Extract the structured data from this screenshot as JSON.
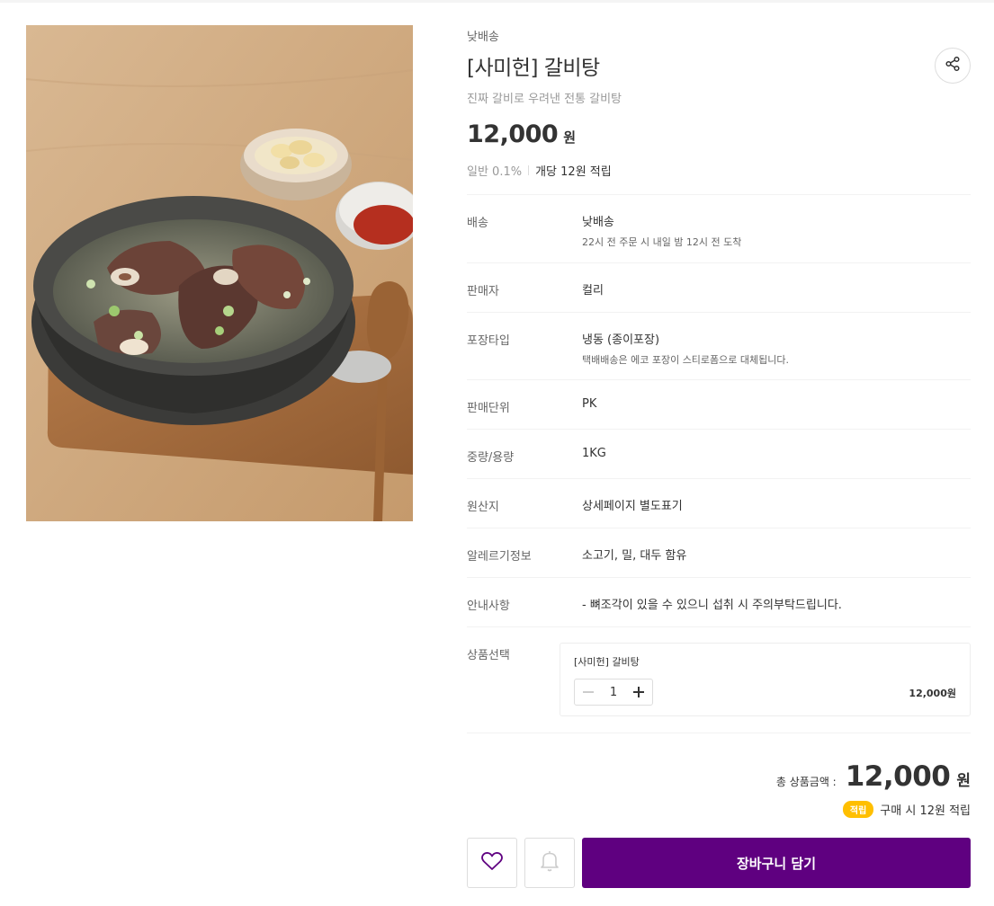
{
  "product": {
    "delivery_tag": "낮배송",
    "title": "[사미헌] 갈비탕",
    "subtitle": "진짜 갈비로 우려낸 전통 갈비탕",
    "price": "12,000",
    "price_unit": "원",
    "points_grade": "일반 0.1%",
    "points_per_unit": "개당 12원 적립"
  },
  "details": [
    {
      "label": "배송",
      "value": "낮배송",
      "sub": "22시 전 주문 시 내일 밤 12시 전 도착"
    },
    {
      "label": "판매자",
      "value": "컬리",
      "sub": ""
    },
    {
      "label": "포장타입",
      "value": "냉동 (종이포장)",
      "sub": "택배배송은 에코 포장이 스티로폼으로 대체됩니다."
    },
    {
      "label": "판매단위",
      "value": "PK",
      "sub": ""
    },
    {
      "label": "중량/용량",
      "value": "1KG",
      "sub": ""
    },
    {
      "label": "원산지",
      "value": "상세페이지 별도표기",
      "sub": ""
    },
    {
      "label": "알레르기정보",
      "value": "소고기, 밀, 대두 함유",
      "sub": ""
    },
    {
      "label": "안내사항",
      "value": "- 뼈조각이 있을 수 있으니 섭취 시 주의부탁드립니다.",
      "sub": ""
    }
  ],
  "option": {
    "label": "상품선택",
    "name": "[사미헌] 갈비탕",
    "quantity": "1",
    "price": "12,000원"
  },
  "total": {
    "label": "총 상품금액 :",
    "amount": "12,000",
    "unit": "원",
    "earn_badge": "적립",
    "earn_text": "구매 시 12원 적립"
  },
  "actions": {
    "cart_label": "장바구니 담기"
  },
  "colors": {
    "brand_purple": "#5f0080",
    "earn_badge": "#ffbf00"
  }
}
